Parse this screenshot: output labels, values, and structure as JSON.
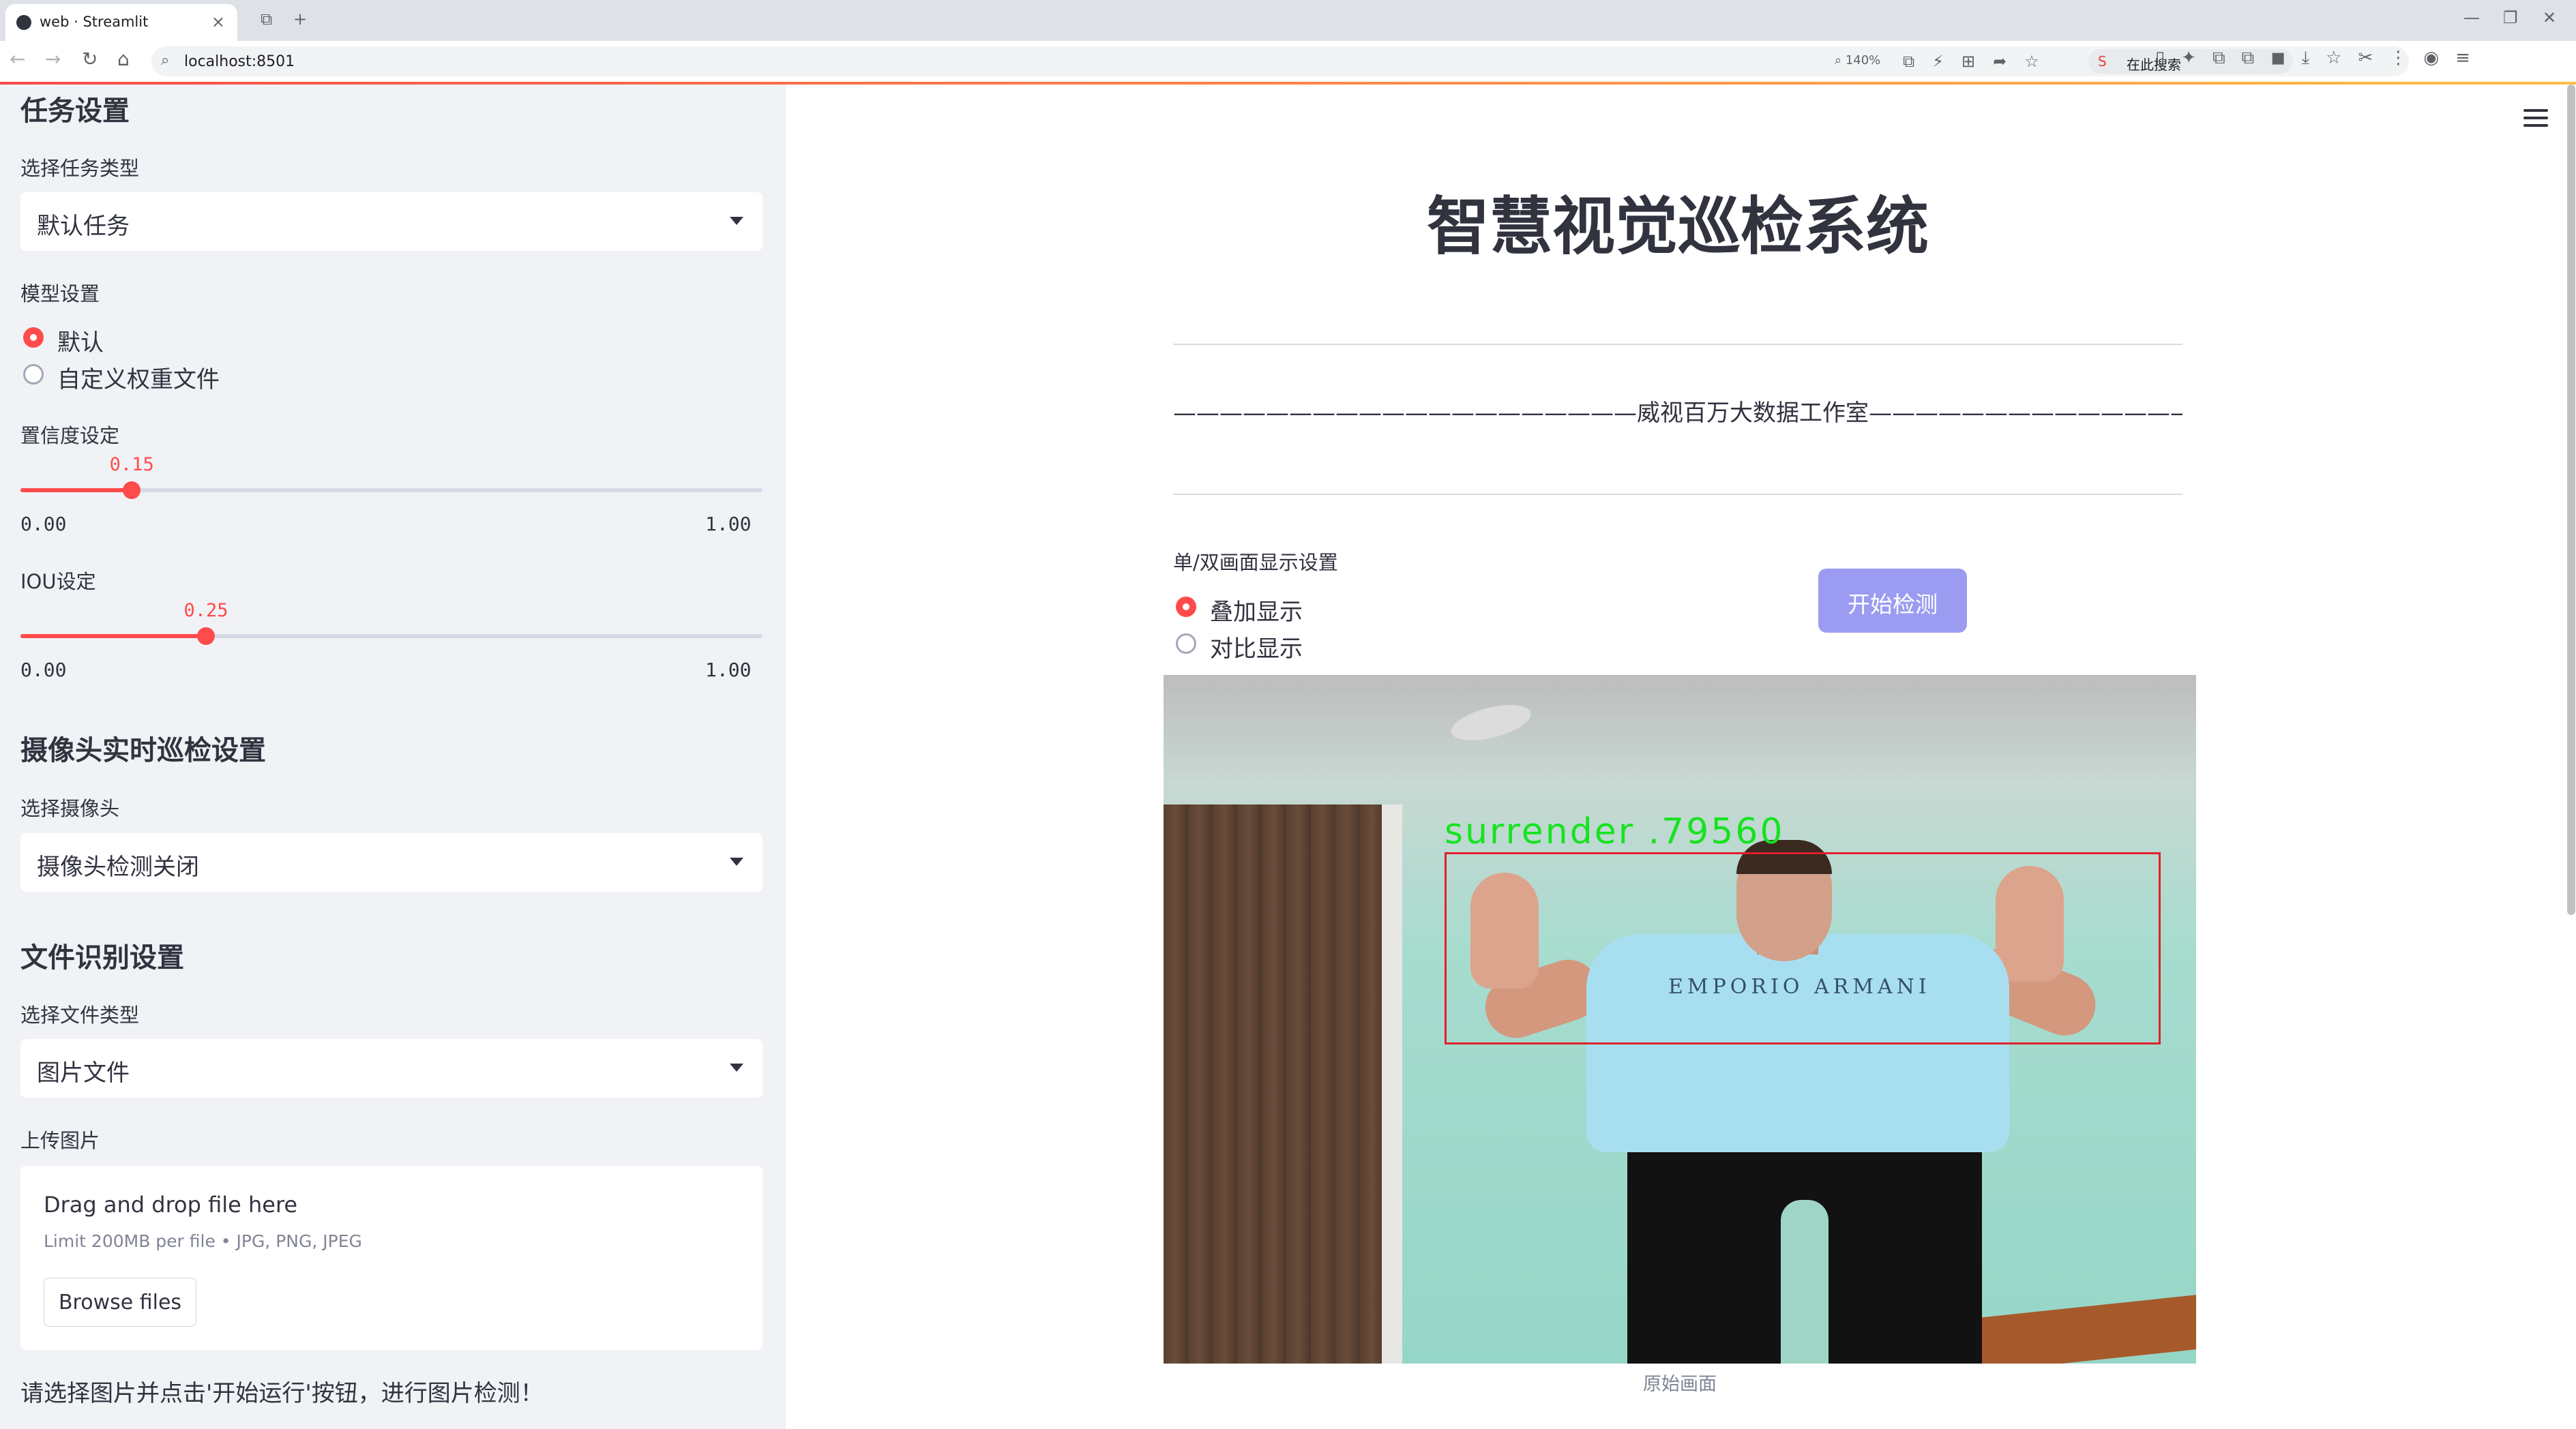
{
  "browser": {
    "tab_title": "web · Streamlit",
    "tab_close": "×",
    "tab_extra": "⧉",
    "new_tab": "+",
    "window_controls": [
      "—",
      "❐",
      "✕"
    ],
    "nav": {
      "back": "←",
      "forward": "→",
      "reload": "↻",
      "home": "⌂"
    },
    "url": "localhost:8501",
    "zoom": "140%",
    "omni_icons": "⧉⚡⊞➦☆",
    "search_logo": "S",
    "search_placeholder": "在此搜索",
    "right_icons": "▯✦⧉⧉◼⤓☆✂⋮◉≡"
  },
  "sidebar": {
    "task_heading": "任务设置",
    "task_type_label": "选择任务类型",
    "task_type_value": "默认任务",
    "model_label": "模型设置",
    "model_options": [
      {
        "label": "默认",
        "selected": true
      },
      {
        "label": "自定义权重文件",
        "selected": false
      }
    ],
    "confidence": {
      "label": "置信度设定",
      "value": "0.15",
      "min": "0.00",
      "max": "1.00",
      "fraction": 0.15
    },
    "iou": {
      "label": "IOU设定",
      "value": "0.25",
      "min": "0.00",
      "max": "1.00",
      "fraction": 0.25
    },
    "camera_heading": "摄像头实时巡检设置",
    "camera_label": "选择摄像头",
    "camera_value": "摄像头检测关闭",
    "file_heading": "文件识别设置",
    "file_type_label": "选择文件类型",
    "file_type_value": "图片文件",
    "upload_label": "上传图片",
    "uploader": {
      "title": "Drag and drop file here",
      "limit": "Limit 200MB per file • JPG, PNG, JPEG",
      "button": "Browse files"
    },
    "note": "请选择图片并点击'开始运行'按钮，进行图片检测！"
  },
  "main": {
    "title": "智慧视觉巡检系统",
    "subtitle": "————————————————————威视百万大数据工作室—————————————————————",
    "display_label": "单/双画面显示设置",
    "display_options": [
      {
        "label": "叠加显示",
        "selected": true
      },
      {
        "label": "对比显示",
        "selected": false
      }
    ],
    "start_button": "开始检测",
    "detection_label": "surrender .79560",
    "shirt_text": "EMPORIO ARMANI",
    "caption": "原始画面"
  },
  "colors": {
    "accent": "#ff4b4b",
    "sidebar_bg": "#f0f2f6",
    "button_bg": "#9b9cf1",
    "box_red": "#e0212b",
    "label_green": "#16e31f"
  }
}
